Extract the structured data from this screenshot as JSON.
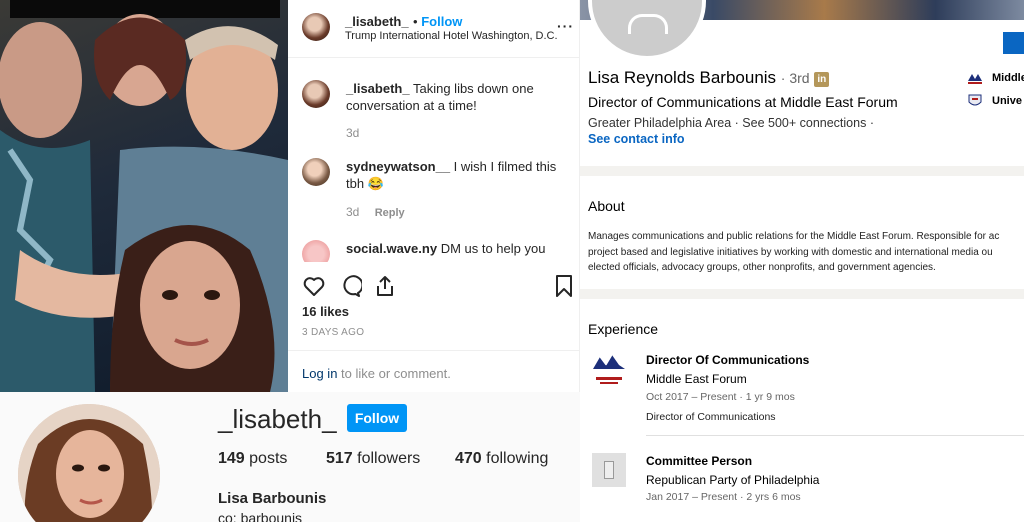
{
  "instagram_post": {
    "username": "_lisabeth_",
    "follow_label": "Follow",
    "location": "Trump International Hotel Washington, D.C.",
    "more_icon": "more-dots-icon",
    "comments": [
      {
        "username": "_lisabeth_",
        "text": "Taking libs down one conversation at a time!",
        "age": "3d",
        "reply": ""
      },
      {
        "username": "sydneywatson__",
        "text": "I wish I filmed this tbh 😂",
        "age": "3d",
        "reply": "Reply"
      },
      {
        "username": "social.wave.ny",
        "text": "DM us to help you",
        "age": "",
        "reply": ""
      }
    ],
    "likes": "16 likes",
    "posted_ago": "3 DAYS AGO",
    "login_link": "Log in",
    "login_suffix": "to like or comment."
  },
  "instagram_profile": {
    "username": "_lisabeth_",
    "follow_label": "Follow",
    "posts_count": "149",
    "posts_label": "posts",
    "followers_count": "517",
    "followers_label": "followers",
    "following_count": "470",
    "following_label": "following",
    "full_name": "Lisa Barbounis",
    "bio_partial": "co: barbounis"
  },
  "linkedin": {
    "name": "Lisa Reynolds Barbounis",
    "degree": "· 3rd",
    "badge": "in",
    "headline": "Director of Communications at Middle East Forum",
    "location": "Greater Philadelphia Area",
    "connections": "See 500+ connections",
    "contact_link": "See contact info",
    "side_orgs": [
      "Middle",
      "Unive"
    ],
    "about_title": "About",
    "about_lines": [
      "Manages communications and public relations for the Middle East Forum. Responsible for ac",
      "project based and legislative initiatives by working with domestic and international media ou",
      "elected officials, advocacy groups, other nonprofits, and government agencies."
    ],
    "experience_title": "Experience",
    "experience": [
      {
        "title": "Director Of Communications",
        "org": "Middle East Forum",
        "dates": "Oct 2017 – Present · 1 yr 9 mos",
        "desc": "Director of Communications",
        "logo_text": "Middle East Forum"
      },
      {
        "title": "Committee Person",
        "org": "Republican Party of Philadelphia",
        "dates": "Jan 2017 – Present · 2 yrs 6 mos",
        "desc": ""
      }
    ]
  },
  "colors": {
    "ig_blue": "#0095f6",
    "li_blue": "#0a66c2",
    "li_badge": "#b4975a"
  }
}
